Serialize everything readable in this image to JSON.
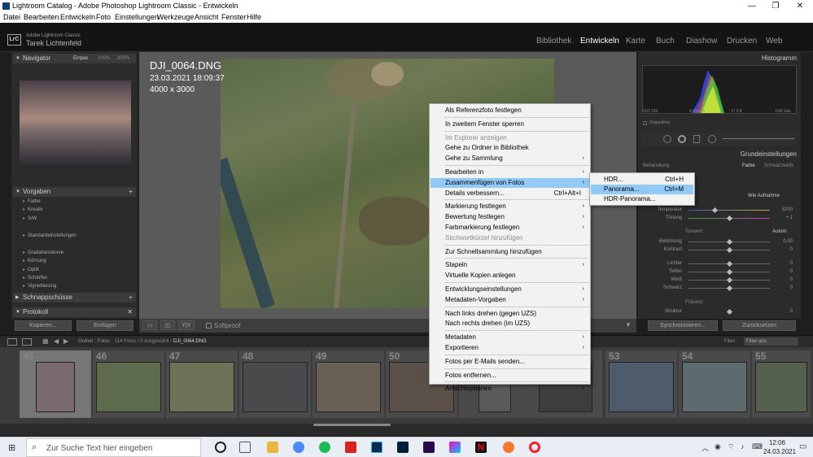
{
  "window": {
    "title": "Lightroom Catalog - Adobe Photoshop Lightroom Classic - Entwickeln",
    "minimize": "—",
    "maximize": "❐",
    "close": "✕"
  },
  "menu": [
    "Datei",
    "Bearbeiten",
    "Entwickeln",
    "Foto",
    "Einstellungen",
    "Werkzeuge",
    "Ansicht",
    "Fenster",
    "Hilfe"
  ],
  "identity": {
    "logo": "LrC",
    "product": "Adobe Lightroom Classic",
    "user": "Tarek Lichtenfeld"
  },
  "modules": [
    "Bibliothek",
    "Entwickeln",
    "Karte",
    "Buch",
    "Diashow",
    "Drucken",
    "Web"
  ],
  "active_module": "Entwickeln",
  "left_panel": {
    "navigator": {
      "title": "Navigator",
      "fit": "Einpas",
      "z1": "100%",
      "z2": "300%"
    },
    "presets": {
      "title": "Vorgaben",
      "items": [
        "Farbe",
        "Kreativ",
        "S/W",
        "Standardeinstellungen",
        "Gradationskurve",
        "Körnung",
        "Optik",
        "Schärfen",
        "Vignettierung"
      ]
    },
    "snapshots": "Schnappschüsse",
    "history": "Protokoll",
    "copy": "Kopieren...",
    "paste": "Einfügen"
  },
  "photo_info": {
    "filename": "DJI_0064.DNG",
    "date": "23.03.2021 18:09:37",
    "dims": "4000 x 3000"
  },
  "toolbar": {
    "softproof": "Softproof"
  },
  "right_panel": {
    "histogram": "Histogramm",
    "iso": "ISO 100",
    "focal": "4,49 mm",
    "aperture": "f / 2,8",
    "shutter": "1/40 Sek.",
    "original": "Originalfoto",
    "basic": "Grundeinstellungen",
    "treatment": "Behandlung:",
    "color": "Farbe",
    "bw": "Schwarzweiß",
    "wb": "Wie Aufnahme",
    "temp_label": "Temperatur",
    "temp_val": "5200",
    "tint_label": "Tönung",
    "tint_val": "+ 1",
    "tone": "Tonwert",
    "auto": "Autom.",
    "exposure": "Belichtung",
    "exposure_val": "0,00",
    "contrast": "Kontrast",
    "contrast_val": "0",
    "lights": "Lichter",
    "lights_val": "0",
    "shadows": "Tiefen",
    "shadows_val": "0",
    "whites": "Weiß",
    "whites_val": "0",
    "blacks": "Schwarz",
    "blacks_val": "0",
    "presence": "Präsenz",
    "texture": "Struktur",
    "texture_val": "0",
    "sync": "Synchronisieren...",
    "reset": "Zurücksetzen"
  },
  "filmstrip_bar": {
    "source": "Ordner : Fotos",
    "count": "114 Fotos / 5 ausgewählt /",
    "file": "DJI_0064.DNG",
    "filter": "Filter:",
    "filter_val": "Filter aus"
  },
  "filmstrip": [
    {
      "num": "45",
      "tone": "#7a6a70"
    },
    {
      "num": "46",
      "tone": "#5d6b4c"
    },
    {
      "num": "47",
      "tone": "#6e7358"
    },
    {
      "num": "48",
      "tone": "#4a4a4c"
    },
    {
      "num": "49",
      "tone": "#6a5f55"
    },
    {
      "num": "50",
      "tone": "#5a5049"
    },
    {
      "num": "53",
      "tone": "#4d5b6c"
    },
    {
      "num": "54",
      "tone": "#5d6a6e"
    },
    {
      "num": "55",
      "tone": "#56604f"
    }
  ],
  "context_menu": {
    "items": [
      {
        "label": "Als Referenzfoto festlegen"
      },
      {
        "sep": true
      },
      {
        "label": "In zweitem Fenster sperren"
      },
      {
        "sep": true
      },
      {
        "label": "Im Explorer anzeigen",
        "disabled": true
      },
      {
        "label": "Gehe zu Ordner in Bibliothek"
      },
      {
        "label": "Gehe zu Sammlung",
        "arrow": true
      },
      {
        "sep": true
      },
      {
        "label": "Bearbeiten in",
        "arrow": true
      },
      {
        "label": "Zusammenfügen von Fotos",
        "arrow": true,
        "highlight": true
      },
      {
        "label": "Details verbessern...",
        "shortcut": "Ctrl+Alt+I"
      },
      {
        "sep": true
      },
      {
        "label": "Markierung festlegen",
        "arrow": true
      },
      {
        "label": "Bewertung festlegen",
        "arrow": true
      },
      {
        "label": "Farbmarkierung festlegen",
        "arrow": true
      },
      {
        "label": "Stichwortkürzel hinzufügen",
        "disabled": true
      },
      {
        "sep": true
      },
      {
        "label": "Zur Schnellsammlung hinzufügen"
      },
      {
        "sep": true
      },
      {
        "label": "Stapeln",
        "arrow": true
      },
      {
        "label": "Virtuelle Kopien anlegen"
      },
      {
        "sep": true
      },
      {
        "label": "Entwicklungseinstellungen",
        "arrow": true
      },
      {
        "label": "Metadaten-Vorgaben",
        "arrow": true
      },
      {
        "sep": true
      },
      {
        "label": "Nach links drehen (gegen UZS)"
      },
      {
        "label": "Nach rechts drehen (im UZS)"
      },
      {
        "sep": true
      },
      {
        "label": "Metadaten",
        "arrow": true
      },
      {
        "label": "Exportieren",
        "arrow": true
      },
      {
        "sep": true
      },
      {
        "label": "Fotos per E-Mails senden..."
      },
      {
        "sep": true
      },
      {
        "label": "Fotos entfernen..."
      },
      {
        "sep": true
      },
      {
        "label": "Ansichtoptionen",
        "arrow": true
      }
    ]
  },
  "submenu": [
    {
      "label": "HDR...",
      "shortcut": "Ctrl+H"
    },
    {
      "label": "Panorama...",
      "shortcut": "Ctrl+M",
      "highlight": true
    },
    {
      "label": "HDR-Panorama..."
    }
  ],
  "taskbar": {
    "search_placeholder": "Zur Suche Text hier eingeben",
    "time": "12:06",
    "date": "24.03.2021"
  }
}
